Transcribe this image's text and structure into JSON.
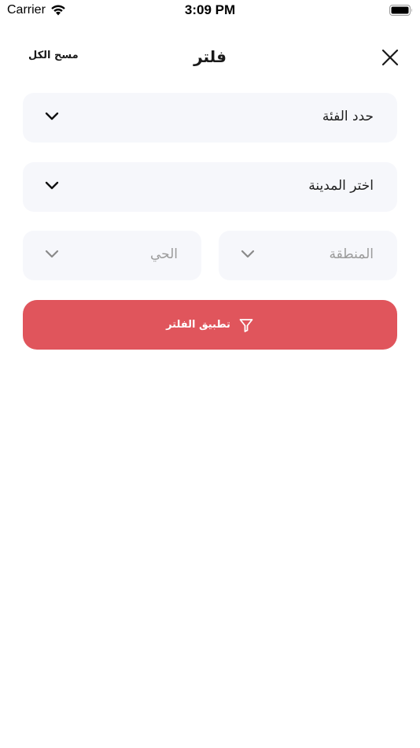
{
  "status_bar": {
    "carrier": "Carrier",
    "time": "3:09 PM",
    "icons": [
      "wifi-icon",
      "battery-icon"
    ]
  },
  "header": {
    "title": "فلتر",
    "clear_all_label": "مسح الكل",
    "close_icon": "close-icon"
  },
  "filters": {
    "category": {
      "label": "حدد الفئة",
      "icon": "chevron-down-icon"
    },
    "city": {
      "label": "اختر المدينة",
      "icon": "chevron-down-icon"
    },
    "region": {
      "label": "المنطقة",
      "icon": "chevron-down-icon"
    },
    "district": {
      "label": "الحي",
      "icon": "chevron-down-icon"
    }
  },
  "apply_button": {
    "label": "تطبيق الفلتر",
    "icon": "funnel-icon"
  },
  "colors": {
    "accent": "#e0555c",
    "field_background": "#f6f7fb",
    "placeholder_text": "#9b9b9b",
    "background": "#ffffff"
  }
}
